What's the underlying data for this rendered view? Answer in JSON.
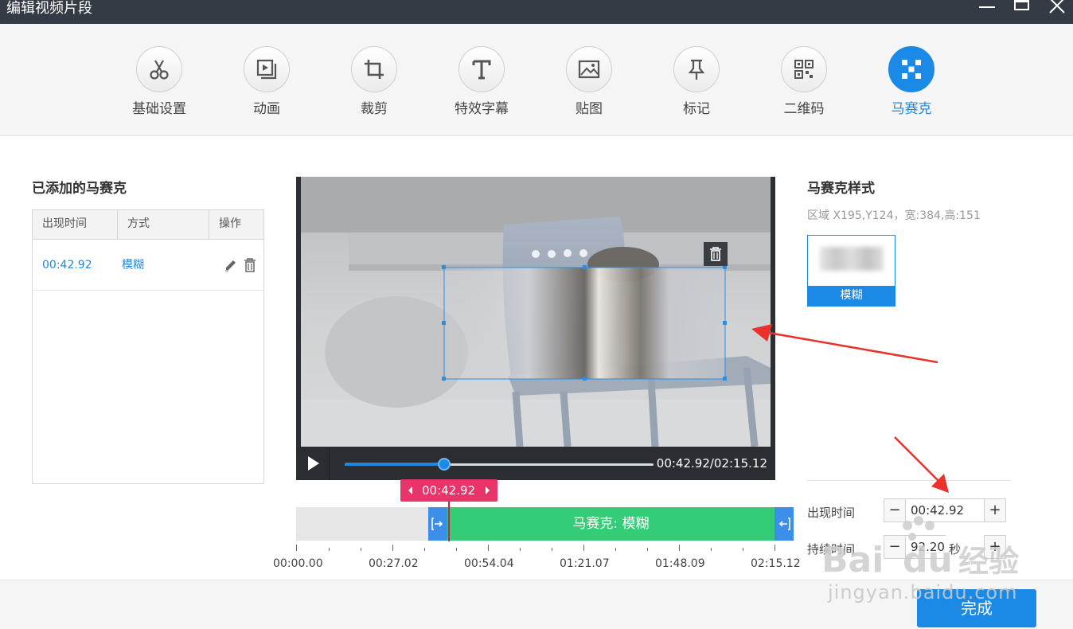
{
  "window": {
    "title": "编辑视频片段",
    "controls": [
      "minimize-icon",
      "maximize-icon",
      "close-icon"
    ]
  },
  "toolbar": {
    "tools": [
      {
        "label": "基础设置",
        "icon": "scissors-icon",
        "active": false
      },
      {
        "label": "动画",
        "icon": "play-frame-icon",
        "active": false
      },
      {
        "label": "裁剪",
        "icon": "crop-icon",
        "active": false
      },
      {
        "label": "特效字幕",
        "icon": "text-icon",
        "active": false
      },
      {
        "label": "贴图",
        "icon": "image-icon",
        "active": false
      },
      {
        "label": "标记",
        "icon": "pin-icon",
        "active": false
      },
      {
        "label": "二维码",
        "icon": "qrcode-icon",
        "active": false
      },
      {
        "label": "马赛克",
        "icon": "mosaic-icon",
        "active": true
      }
    ]
  },
  "left_panel": {
    "heading": "已添加的马赛克",
    "columns": [
      "出现时间",
      "方式",
      "操作"
    ],
    "rows": [
      {
        "time": "00:42.92",
        "mode": "模糊",
        "actions": [
          "edit-icon",
          "delete-icon"
        ]
      }
    ]
  },
  "player": {
    "time_readout": "00:42.92/02:15.12",
    "progress": 0.318
  },
  "timeline": {
    "playhead_label": "00:42.92",
    "segment_label": "马赛克: 模糊",
    "ticks": [
      "00:00.00",
      "00:27.02",
      "00:54.04",
      "01:21.07",
      "01:48.09",
      "02:15.12"
    ]
  },
  "right_panel": {
    "heading": "马赛克样式",
    "region": "区域 X195,Y124，宽:384,高:151",
    "style_option": "模糊",
    "appear_label": "出现时间",
    "appear_value": "00:42.92",
    "duration_label": "持续时间",
    "duration_value": "92.20",
    "duration_unit": "秒"
  },
  "footer": {
    "done_label": "完成"
  },
  "watermark": {
    "brand": "Baidu经验",
    "url": "jingyan.baidu.com"
  },
  "colors": {
    "accent": "#1a8ae6",
    "segment": "#33cc77",
    "playhead": "#e8336b",
    "titlebar": "#353b44"
  }
}
